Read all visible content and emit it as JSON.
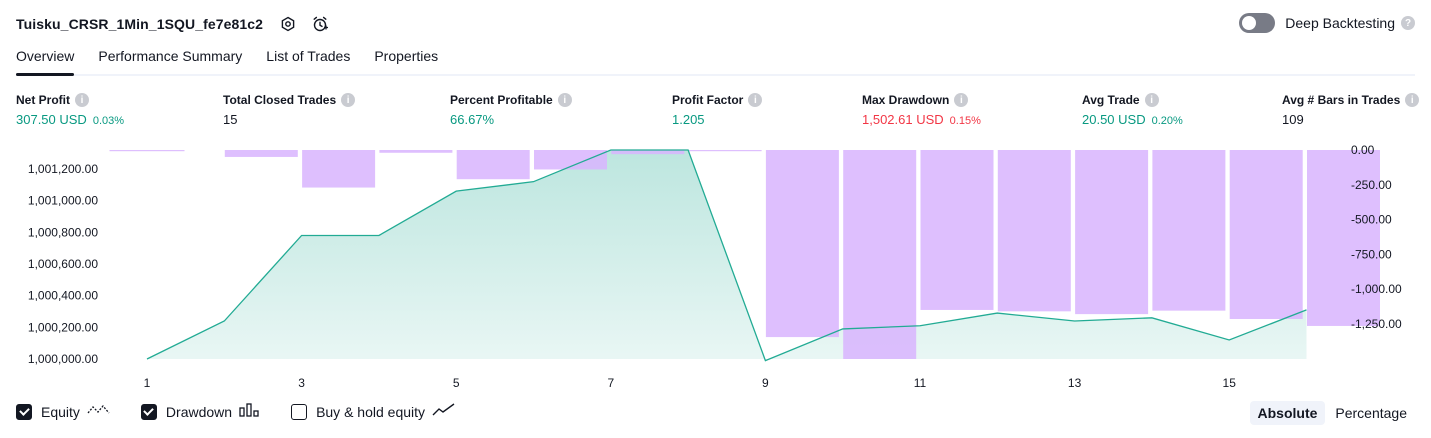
{
  "header": {
    "title": "Tuisku_CRSR_1Min_1SQU_fe7e81c2",
    "deep_backtesting_label": "Deep Backtesting",
    "deep_backtesting_enabled": false
  },
  "tabs": [
    {
      "label": "Overview",
      "active": true
    },
    {
      "label": "Performance Summary",
      "active": false
    },
    {
      "label": "List of Trades",
      "active": false
    },
    {
      "label": "Properties",
      "active": false
    }
  ],
  "metrics": {
    "net_profit": {
      "label": "Net Profit",
      "value": "307.50 USD",
      "pct": "0.03%"
    },
    "total_closed_trades": {
      "label": "Total Closed Trades",
      "value": "15"
    },
    "percent_profitable": {
      "label": "Percent Profitable",
      "value": "66.67%"
    },
    "profit_factor": {
      "label": "Profit Factor",
      "value": "1.205"
    },
    "max_drawdown": {
      "label": "Max Drawdown",
      "value": "1,502.61 USD",
      "pct": "0.15%"
    },
    "avg_trade": {
      "label": "Avg Trade",
      "value": "20.50 USD",
      "pct": "0.20%"
    },
    "avg_bars": {
      "label": "Avg # Bars in Trades",
      "value": "109"
    }
  },
  "colors": {
    "positive": "#089981",
    "negative": "#f23645",
    "equity_line": "#22ab94",
    "drawdown_bar": "#d8b4fe"
  },
  "chart_data": {
    "type": "area",
    "x": [
      1,
      2,
      3,
      4,
      5,
      6,
      7,
      8,
      9,
      10,
      11,
      12,
      13,
      14,
      15,
      16
    ],
    "x_tick_labels": [
      "1",
      "3",
      "5",
      "7",
      "9",
      "11",
      "13",
      "15"
    ],
    "series": [
      {
        "name": "Equity",
        "axis": "left",
        "values": [
          1000000,
          1000240,
          1000780,
          1000780,
          1001060,
          1001120,
          1001320,
          1001320,
          999990,
          1000190,
          1000210,
          1000290,
          1000240,
          1000260,
          1000120,
          1000310
        ]
      },
      {
        "name": "Drawdown",
        "axis": "right",
        "type": "bar",
        "values": [
          0,
          -50,
          -270,
          -20,
          -210,
          -140,
          -30,
          0,
          -1345,
          -1502.61,
          -1150,
          -1160,
          -1180,
          -1155,
          -1215,
          -1265
        ]
      }
    ],
    "left_axis": {
      "ticks": [
        "1,000,000.00",
        "1,000,200.00",
        "1,000,400.00",
        "1,000,600.00",
        "1,000,800.00",
        "1,001,000.00",
        "1,001,200.00"
      ],
      "range": [
        1000000,
        1001320
      ]
    },
    "right_axis": {
      "ticks": [
        "0.00",
        "-250.00",
        "-500.00",
        "-750.00",
        "-1,000.00",
        "-1,250.00"
      ],
      "range": [
        -1502.61,
        0
      ]
    }
  },
  "legend": {
    "equity": {
      "label": "Equity",
      "checked": true
    },
    "drawdown": {
      "label": "Drawdown",
      "checked": true
    },
    "buy_hold": {
      "label": "Buy & hold equity",
      "checked": false
    }
  },
  "mode": {
    "absolute": "Absolute",
    "percentage": "Percentage",
    "active": "absolute"
  }
}
